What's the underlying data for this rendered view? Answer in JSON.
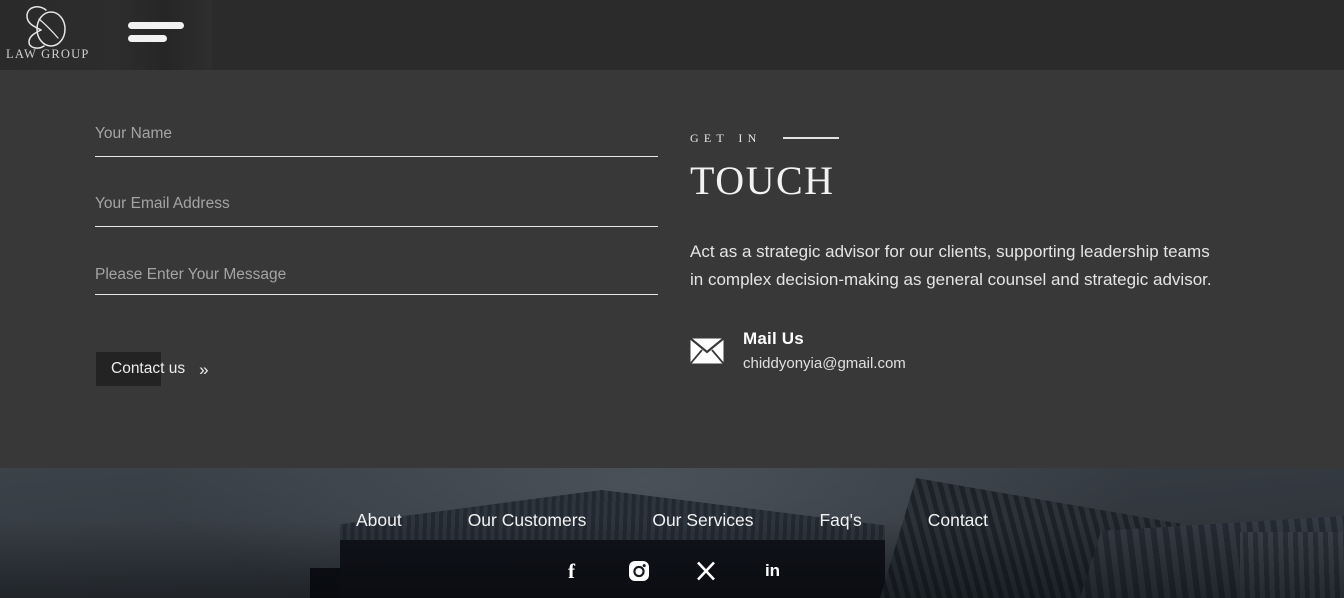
{
  "header": {
    "logo_word": "LAW GROUP",
    "logo_icon": "co-monogram-logo",
    "menu_icon": "hamburger-menu-icon"
  },
  "form": {
    "name_placeholder": "Your Name",
    "name_value": "",
    "email_placeholder": "Your Email Address",
    "email_value": "",
    "message_placeholder": "Please Enter Your Message",
    "message_value": "",
    "submit_label": "Contact us",
    "submit_chevron": "»"
  },
  "info": {
    "eyebrow": "GET IN",
    "heading": "TOUCH",
    "paragraph": "Act as a strategic advisor for our clients, supporting leadership teams in complex decision-making as general counsel and strategic advisor.",
    "mail_icon": "envelope-icon",
    "mail_title": "Mail Us",
    "mail_address": "chiddyonyia@gmail.com"
  },
  "footer": {
    "nav": [
      {
        "label": "About"
      },
      {
        "label": "Our Customers"
      },
      {
        "label": "Our Services"
      },
      {
        "label": "Faq's"
      },
      {
        "label": "Contact"
      }
    ],
    "socials": [
      {
        "name": "facebook-icon",
        "glyph": "f"
      },
      {
        "name": "instagram-icon",
        "glyph": ""
      },
      {
        "name": "x-twitter-icon",
        "glyph": "✕"
      },
      {
        "name": "linkedin-icon",
        "glyph": "in"
      }
    ]
  },
  "colors": {
    "header_bg": "#2b2b2b",
    "body_bg": "#383838",
    "text": "#e9e9e9",
    "placeholder": "#a4a4a4",
    "button_bg": "#232323",
    "footer_sky": "#3b4249"
  }
}
